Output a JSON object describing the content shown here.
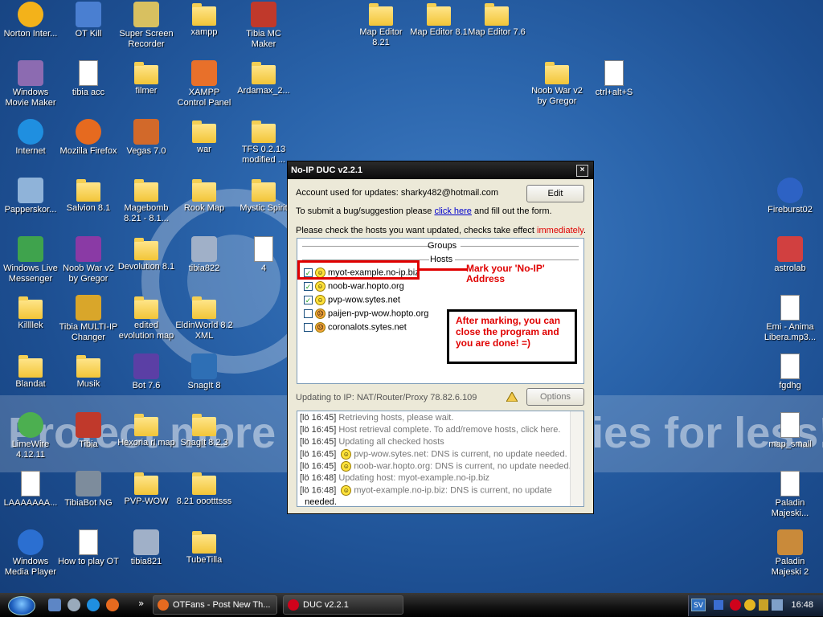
{
  "desktop": {
    "watermark_word": "bucket",
    "banner_text": "Protect more of your memories for less!",
    "icons": [
      {
        "label": "Norton Inter...",
        "kind": "round",
        "color": "#f3b21a"
      },
      {
        "label": "OT Kill",
        "kind": "generic",
        "color": "#4a7fd1"
      },
      {
        "label": "Super Screen Recorder",
        "kind": "generic",
        "color": "#d8c060"
      },
      {
        "label": "xampp",
        "kind": "folder"
      },
      {
        "label": "Tibia MC Maker",
        "kind": "generic",
        "color": "#c0392b"
      },
      {
        "label": "Map Editor 8.21",
        "kind": "folder"
      },
      {
        "label": "Map Editor 8.1",
        "kind": "folder"
      },
      {
        "label": "Map Editor 7.6",
        "kind": "folder"
      },
      {
        "label": "Windows Movie Maker",
        "kind": "generic",
        "color": "#8c6bb1"
      },
      {
        "label": "tibia acc",
        "kind": "doc"
      },
      {
        "label": "filmer",
        "kind": "folder"
      },
      {
        "label": "XAMPP Control Panel",
        "kind": "generic",
        "color": "#e8702a"
      },
      {
        "label": "Ardamax_2...",
        "kind": "folder"
      },
      {
        "label": "Noob War v2 by Gregor",
        "kind": "folder"
      },
      {
        "label": "ctrl+alt+S",
        "kind": "doc"
      },
      {
        "label": "Internet",
        "kind": "round",
        "color": "#1f8fe0"
      },
      {
        "label": "Mozilla Firefox",
        "kind": "round",
        "color": "#e66a1f"
      },
      {
        "label": "Vegas 7.0",
        "kind": "generic",
        "color": "#d2692a"
      },
      {
        "label": "war",
        "kind": "folder"
      },
      {
        "label": "TFS 0.2.13 modified ...",
        "kind": "folder"
      },
      {
        "label": "Papperskor...",
        "kind": "generic",
        "color": "#8fb3d9"
      },
      {
        "label": "Salvion 8.1",
        "kind": "folder"
      },
      {
        "label": "Magebomb 8.21 - 8.1...",
        "kind": "folder"
      },
      {
        "label": "Rook Map",
        "kind": "folder"
      },
      {
        "label": "Mystic Spirit",
        "kind": "folder"
      },
      {
        "label": "Fireburst02",
        "kind": "round",
        "color": "#2d62c4"
      },
      {
        "label": "Windows Live Messenger",
        "kind": "generic",
        "color": "#3fa34d"
      },
      {
        "label": "Noob War v2 by Gregor",
        "kind": "generic",
        "color": "#8a3aa5"
      },
      {
        "label": "Devolution 8.1",
        "kind": "folder"
      },
      {
        "label": "tibia822",
        "kind": "generic",
        "color": "#a0b0c8"
      },
      {
        "label": "4",
        "kind": "doc"
      },
      {
        "label": "astrolab",
        "kind": "generic",
        "color": "#d14040"
      },
      {
        "label": "Killllek",
        "kind": "folder"
      },
      {
        "label": "Tibia MULTI-IP Changer",
        "kind": "generic",
        "color": "#d9a62a"
      },
      {
        "label": "edited evolution map",
        "kind": "folder"
      },
      {
        "label": "EldinWorld 8.2 XML",
        "kind": "folder"
      },
      {
        "label": "Emi - Anima Libera.mp3...",
        "kind": "doc"
      },
      {
        "label": "Blandat",
        "kind": "folder"
      },
      {
        "label": "Musik",
        "kind": "folder"
      },
      {
        "label": "Bot 7.6",
        "kind": "generic",
        "color": "#5b3fa5"
      },
      {
        "label": "SnagIt 8",
        "kind": "generic",
        "color": "#2e6fb5"
      },
      {
        "label": "fgdhg",
        "kind": "doc"
      },
      {
        "label": "LimeWire 4.12.11",
        "kind": "round",
        "color": "#4caf50"
      },
      {
        "label": "Tibia",
        "kind": "generic",
        "color": "#c0392b"
      },
      {
        "label": "Hexoria rl map",
        "kind": "folder"
      },
      {
        "label": "SnagIt 8.2.3",
        "kind": "folder"
      },
      {
        "label": "map_small",
        "kind": "doc"
      },
      {
        "label": "LAAAAAAA...",
        "kind": "doc"
      },
      {
        "label": "TibiaBot NG",
        "kind": "generic",
        "color": "#7d8c9c"
      },
      {
        "label": "PVP-WOW",
        "kind": "folder"
      },
      {
        "label": "8.21 oootttsss",
        "kind": "folder"
      },
      {
        "label": "Paladin Majeski...",
        "kind": "doc"
      },
      {
        "label": "Windows Media Player",
        "kind": "round",
        "color": "#2b6fd1"
      },
      {
        "label": "How to play OT",
        "kind": "doc"
      },
      {
        "label": "tibia821",
        "kind": "generic",
        "color": "#a0b0c8"
      },
      {
        "label": "TubeTilla",
        "kind": "folder"
      },
      {
        "label": "Paladin Majeski 2",
        "kind": "generic",
        "color": "#c98a3a"
      }
    ]
  },
  "dialog": {
    "title": "No-IP DUC v2.2.1",
    "close_icon": "×",
    "account_label": "Account used for updates: sharky482@hotmail.com",
    "edit_button": "Edit",
    "bug_prefix": "To submit a bug/suggestion please ",
    "bug_link": "click here",
    "bug_suffix": " and fill out the form.",
    "hosts_prompt": "Please check the hosts you want updated, checks take effect ",
    "hosts_prompt_emph": "immediately",
    "hosts_prompt_end": ".",
    "groups_label": "Groups",
    "hosts_label": "Hosts",
    "hosts": [
      {
        "name": "myot-example.no-ip.biz",
        "checked": true,
        "mood": "happy"
      },
      {
        "name": "noob-war.hopto.org",
        "checked": true,
        "mood": "happy"
      },
      {
        "name": "pvp-wow.sytes.net",
        "checked": true,
        "mood": "happy"
      },
      {
        "name": "paijen-pvp-wow.hopto.org",
        "checked": false,
        "mood": "sad"
      },
      {
        "name": "coronalots.sytes.net",
        "checked": false,
        "mood": "sad"
      }
    ],
    "status_text": "Updating to IP: NAT/Router/Proxy 78.82.6.109",
    "options_button": "Options",
    "log": [
      {
        "time": "[lö 16:45]",
        "text": "Retrieving hosts, please wait.",
        "icon": false
      },
      {
        "time": "[lö 16:45]",
        "text": "Host retrieval complete. To add/remove hosts, click here.",
        "icon": false
      },
      {
        "time": "[lö 16:45]",
        "text": "Updating all checked hosts",
        "icon": false
      },
      {
        "time": "[lö 16:45]",
        "text": "pvp-wow.sytes.net: DNS is current, no update needed.",
        "icon": true
      },
      {
        "time": "[lö 16:45]",
        "text": "noob-war.hopto.org: DNS is current, no update needed.",
        "icon": true
      },
      {
        "time": "[lö 16:48]",
        "text": "Updating host: myot-example.no-ip.biz",
        "icon": false
      },
      {
        "time": "[lö 16:48]",
        "text": "myot-example.no-ip.biz: DNS is current, no update",
        "icon": true
      },
      {
        "time": "",
        "text": "needed.",
        "icon": false
      }
    ]
  },
  "annotations": {
    "mark_note": "Mark your 'No-IP' Address",
    "done_note": "After marking, you can close the program and you are done! =)"
  },
  "taskbar": {
    "tasks": [
      {
        "label": "OTFans - Post New Th...",
        "color": "#e66a1f"
      },
      {
        "label": "DUC v2.2.1",
        "color": "#d0021b"
      }
    ],
    "tray_lang": "SV",
    "clock": "16:48"
  }
}
